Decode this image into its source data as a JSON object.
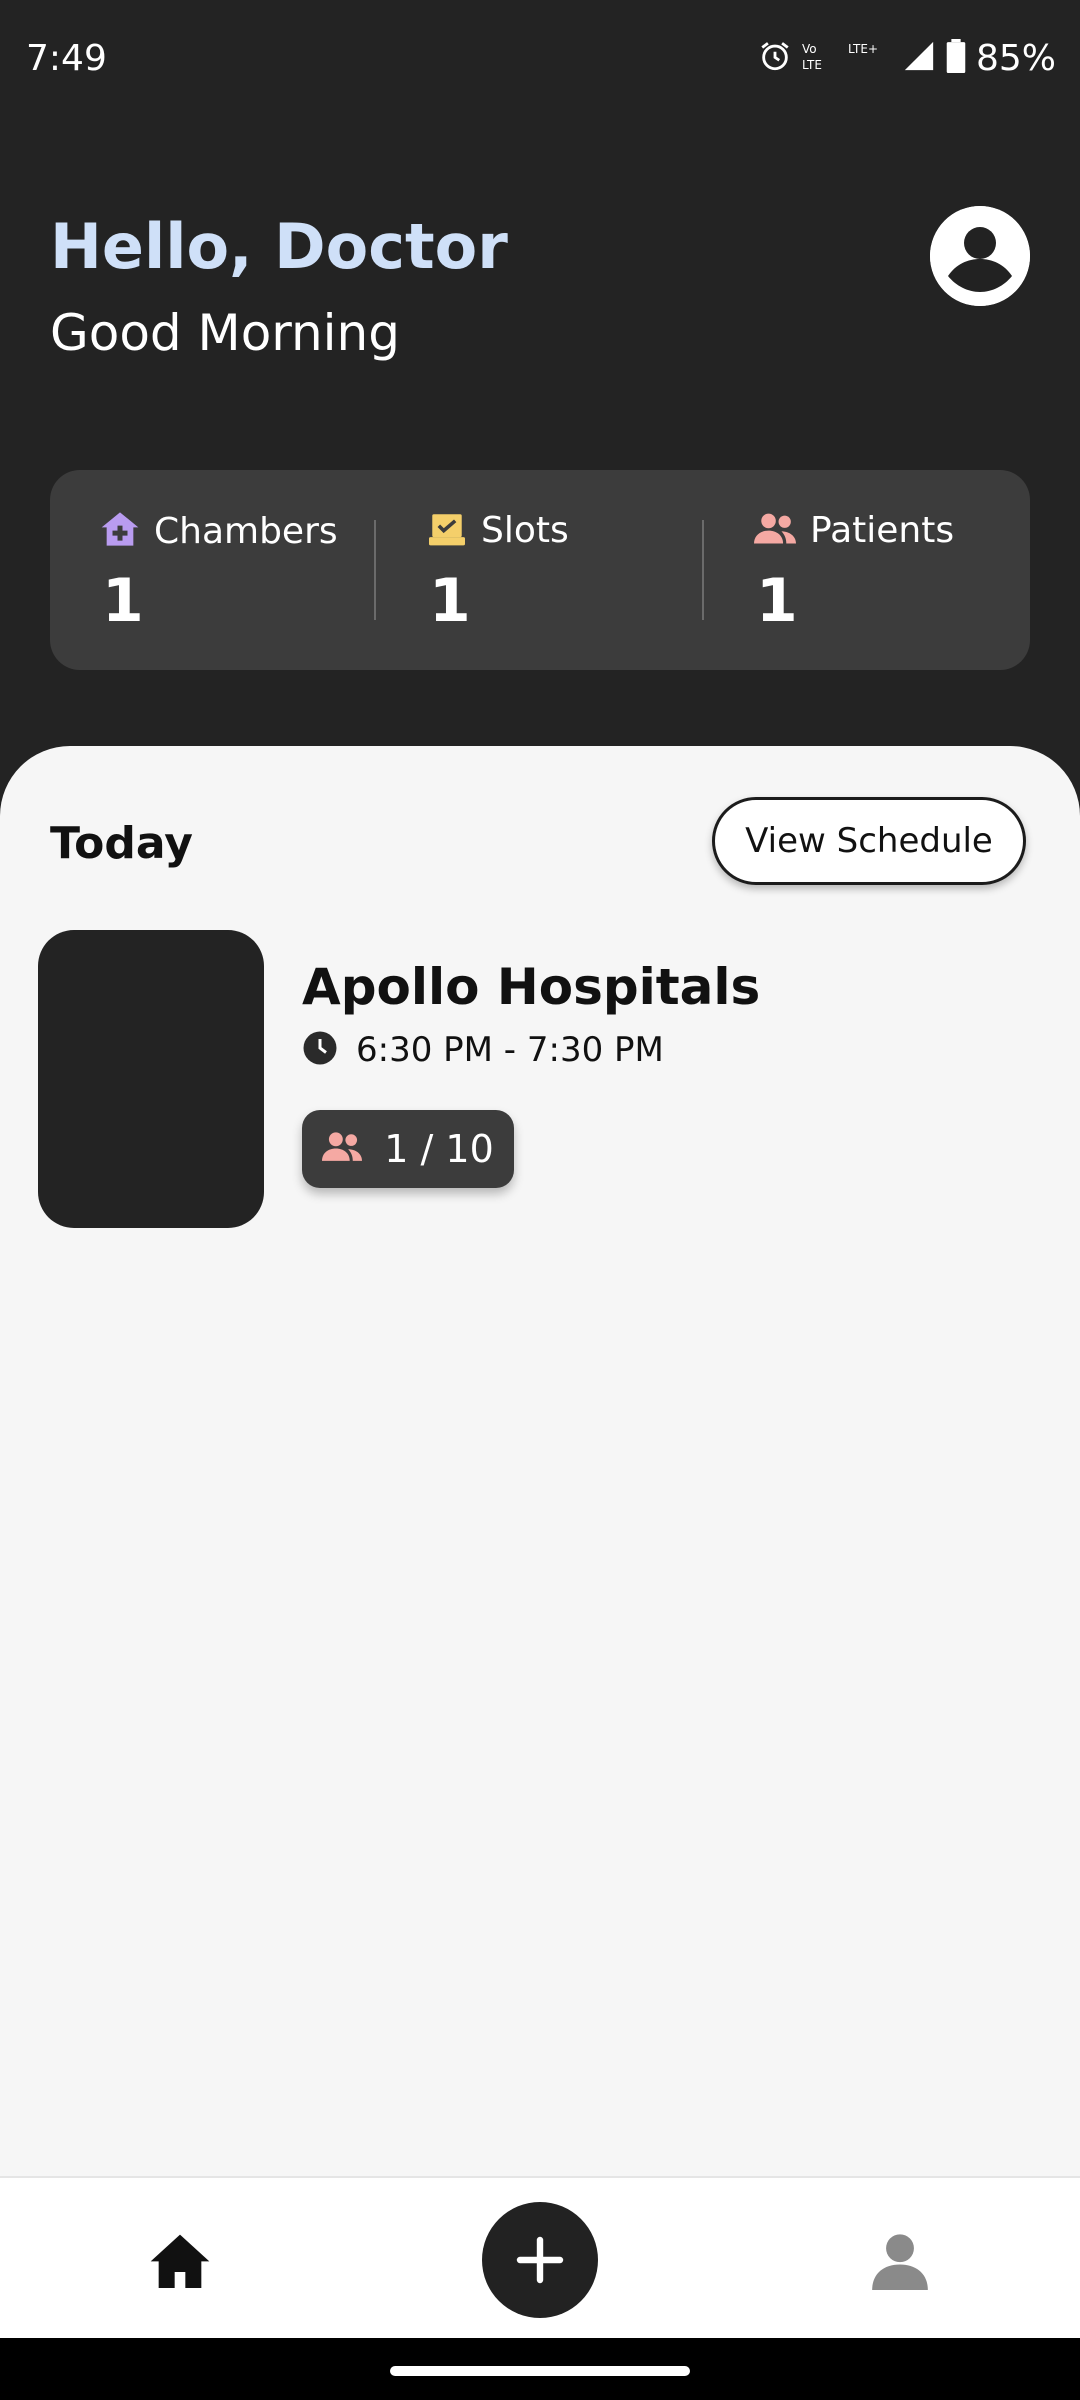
{
  "status_bar": {
    "time": "7:49",
    "battery": "85%",
    "icons": [
      "alarm-icon",
      "volte-icon",
      "lte-icon",
      "signal-icon",
      "battery-icon"
    ]
  },
  "header": {
    "title": "Hello, Doctor",
    "subtitle": "Good Morning",
    "avatar_icon": "account-circle-icon"
  },
  "stats": {
    "chambers": {
      "label": "Chambers",
      "value": "1",
      "icon": "hospital-icon",
      "color": "#b99cf0"
    },
    "slots": {
      "label": "Slots",
      "value": "1",
      "icon": "calendar-check-icon",
      "color": "#f4cf6a"
    },
    "patients": {
      "label": "Patients",
      "value": "1",
      "icon": "people-icon",
      "color": "#f5a9a3"
    }
  },
  "today": {
    "label": "Today",
    "view_schedule_label": "View Schedule"
  },
  "chamber_card": {
    "name": "Apollo Hospitals",
    "time": "6:30 PM - 7:30 PM",
    "patients": "1 / 10"
  },
  "bottom_nav": {
    "items": [
      "home-icon",
      "add-icon",
      "profile-icon"
    ]
  },
  "colors": {
    "background_dark": "#232323",
    "card_dark": "#3c3c3c",
    "greeting_blue": "#cfe0f8",
    "sheet_light": "#f6f6f6"
  }
}
